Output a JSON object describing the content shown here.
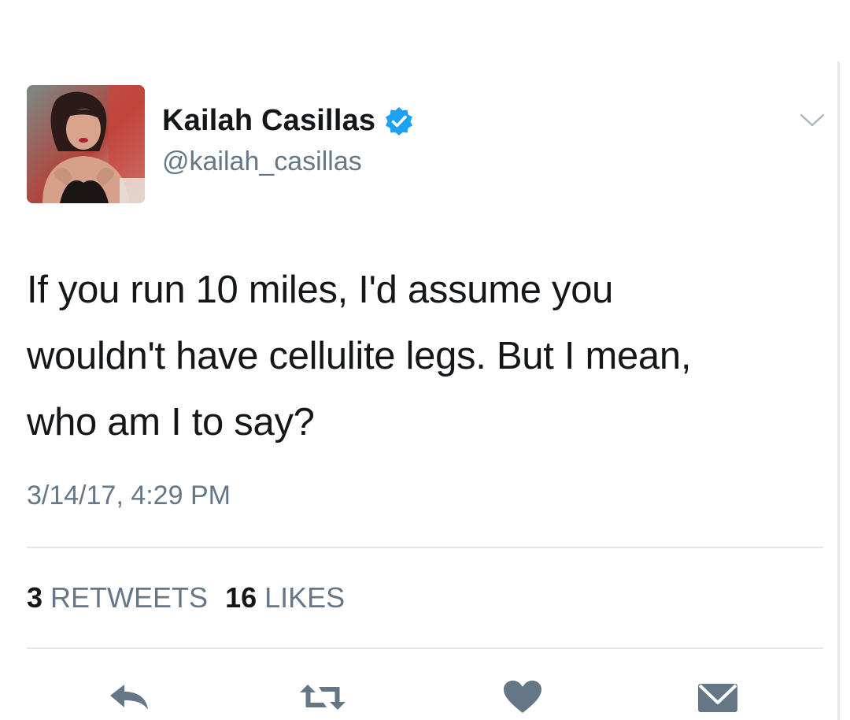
{
  "author": {
    "name": "Kailah Casillas",
    "handle": "@kailah_casillas",
    "verified": true,
    "avatar_icon": "profile-photo"
  },
  "tweet": {
    "lines": [
      "If you run 10 miles, I'd assume you",
      "wouldn't have cellulite legs. But I mean,",
      "who am I to say?"
    ],
    "timestamp": "3/14/17, 4:29 PM"
  },
  "stats": {
    "retweets_count": "3",
    "retweets_label": "RETWEETS",
    "likes_count": "16",
    "likes_label": "LIKES"
  },
  "actions": [
    {
      "name": "reply",
      "icon": "reply-icon"
    },
    {
      "name": "retweet",
      "icon": "retweet-icon"
    },
    {
      "name": "like",
      "icon": "heart-icon"
    },
    {
      "name": "direct-message",
      "icon": "envelope-icon"
    }
  ],
  "colors": {
    "text_primary": "#14171a",
    "text_secondary": "#657786",
    "verified_blue": "#1da1f2",
    "icon_gray": "#657786",
    "divider": "#e1e8ed"
  }
}
